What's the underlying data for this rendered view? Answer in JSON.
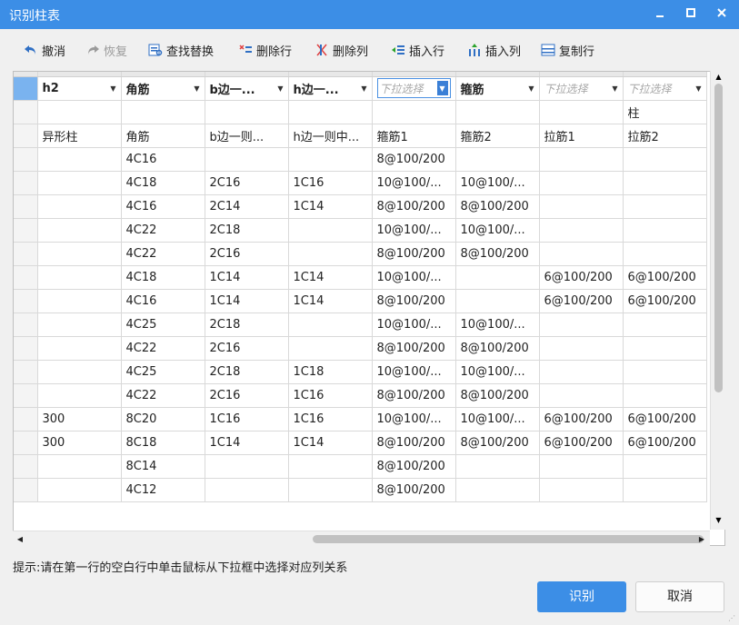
{
  "window": {
    "title": "识别柱表",
    "minimize_icon": "minimize-icon",
    "maximize_icon": "maximize-icon",
    "close_icon": "close-icon"
  },
  "toolbar": {
    "undo": "撤消",
    "redo": "恢复",
    "find_replace": "查找替换",
    "delete_row": "删除行",
    "delete_col": "删除列",
    "insert_row": "插入行",
    "insert_col": "插入列",
    "copy_row": "复制行"
  },
  "grid": {
    "dropdowns": [
      {
        "label": "h2",
        "placeholder": false
      },
      {
        "label": "角筋",
        "placeholder": false
      },
      {
        "label": "b边一...",
        "placeholder": false
      },
      {
        "label": "h边一...",
        "placeholder": false
      },
      {
        "label": "下拉选择",
        "placeholder": true,
        "active": true
      },
      {
        "label": "箍筋",
        "placeholder": false
      },
      {
        "label": "下拉选择",
        "placeholder": true
      },
      {
        "label": "下拉选择",
        "placeholder": true
      }
    ],
    "row_extra": [
      "",
      "",
      "",
      "",
      "",
      "",
      "",
      "柱"
    ],
    "row_headers": [
      "异形柱",
      "角筋",
      "b边一则...",
      "h边一则中...",
      "箍筋1",
      "箍筋2",
      "拉筋1",
      "拉筋2"
    ],
    "rows": [
      [
        "",
        "4C16",
        "",
        "",
        "8@100/200",
        "",
        "",
        ""
      ],
      [
        "",
        "4C18",
        "2C16",
        "1C16",
        "10@100/...",
        "10@100/...",
        "",
        ""
      ],
      [
        "",
        "4C16",
        "2C14",
        "1C14",
        "8@100/200",
        "8@100/200",
        "",
        ""
      ],
      [
        "",
        "4C22",
        "2C18",
        "",
        "10@100/...",
        "10@100/...",
        "",
        ""
      ],
      [
        "",
        "4C22",
        "2C16",
        "",
        "8@100/200",
        "8@100/200",
        "",
        ""
      ],
      [
        "",
        "4C18",
        "1C14",
        "1C14",
        "10@100/...",
        "",
        "6@100/200",
        "6@100/200"
      ],
      [
        "",
        "4C16",
        "1C14",
        "1C14",
        "8@100/200",
        "",
        "6@100/200",
        "6@100/200"
      ],
      [
        "",
        "4C25",
        "2C18",
        "",
        "10@100/...",
        "10@100/...",
        "",
        ""
      ],
      [
        "",
        "4C22",
        "2C16",
        "",
        "8@100/200",
        "8@100/200",
        "",
        ""
      ],
      [
        "",
        "4C25",
        "2C18",
        "1C18",
        "10@100/...",
        "10@100/...",
        "",
        ""
      ],
      [
        "",
        "4C22",
        "2C16",
        "1C16",
        "8@100/200",
        "8@100/200",
        "",
        ""
      ],
      [
        "300",
        "8C20",
        "1C16",
        "1C16",
        "10@100/...",
        "10@100/...",
        "6@100/200",
        "6@100/200"
      ],
      [
        "300",
        "8C18",
        "1C14",
        "1C14",
        "8@100/200",
        "8@100/200",
        "6@100/200",
        "6@100/200"
      ],
      [
        "",
        "8C14",
        "",
        "",
        "8@100/200",
        "",
        "",
        ""
      ],
      [
        "",
        "4C12",
        "",
        "",
        "8@100/200",
        "",
        "",
        ""
      ]
    ]
  },
  "hint": "提示:请在第一行的空白行中单击鼠标从下拉框中选择对应列关系",
  "buttons": {
    "recognize": "识别",
    "cancel": "取消"
  },
  "colors": {
    "accent": "#3c8ee6",
    "selection": "#7ab3ef"
  }
}
